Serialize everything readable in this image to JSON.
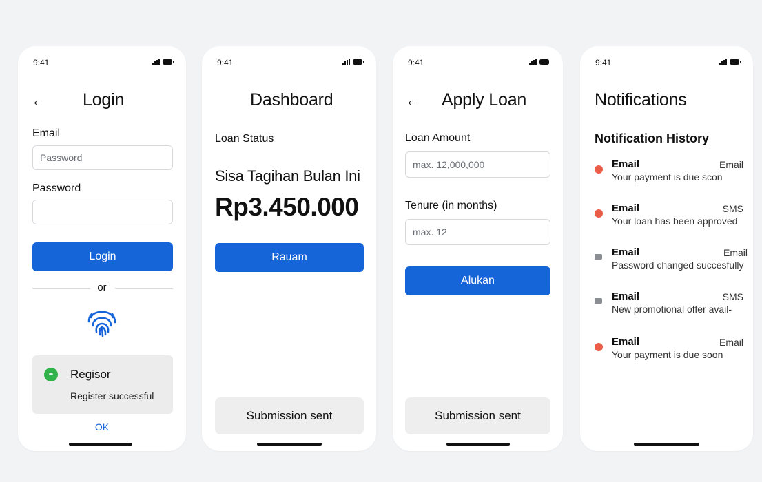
{
  "colors": {
    "accent": "#1665d8",
    "success": "#31b24a",
    "alert": "#ea5b48",
    "muted": "#8a8d92",
    "background": "#f2f3f5"
  },
  "login_screen": {
    "status_time": "9:41",
    "title": "Login",
    "email_label": "Email",
    "email_placeholder": "Password",
    "password_label": "Password",
    "password_value": "",
    "login_button": "Login",
    "or_text": "or",
    "fingerprint_icon": "fingerprint-icon",
    "toast": {
      "icon": "link-icon",
      "title": "Regisor",
      "message": "Register successful"
    },
    "ok_label": "OK"
  },
  "dashboard_screen": {
    "status_time": "9:41",
    "title": "Dashboard",
    "loan_status_label": "Loan Status",
    "bill_label": "Sisa Tagihan Bulan Ini",
    "bill_amount": "Rp3.450.000",
    "primary_button": "Rauam",
    "submission_button": "Submission sent"
  },
  "apply_loan_screen": {
    "status_time": "9:41",
    "title": "Apply Loan",
    "amount_label": "Loan Amount",
    "amount_placeholder": "max. 12,000,000",
    "tenure_label": "Tenure (in months)",
    "tenure_placeholder": "max. 12",
    "primary_button": "Alukan",
    "submission_button": "Submission sent"
  },
  "notifications_screen": {
    "status_time": "9:41",
    "title": "Notifications",
    "history_title": "Notification History",
    "items": [
      {
        "title": "Email",
        "channel": "Email",
        "message": "Your payment is due scon",
        "dot": "red"
      },
      {
        "title": "Email",
        "channel": "SMS",
        "message": "Your loan has been approved",
        "dot": "red"
      },
      {
        "title": "Email",
        "channel": "Email",
        "message": "Password changed succesfully",
        "dot": "grey"
      },
      {
        "title": "Email",
        "channel": "SMS",
        "message": "New promotional offer avail-",
        "dot": "grey"
      },
      {
        "title": "Email",
        "channel": "Email",
        "message": "Your payment is due soon",
        "dot": "red"
      }
    ]
  }
}
